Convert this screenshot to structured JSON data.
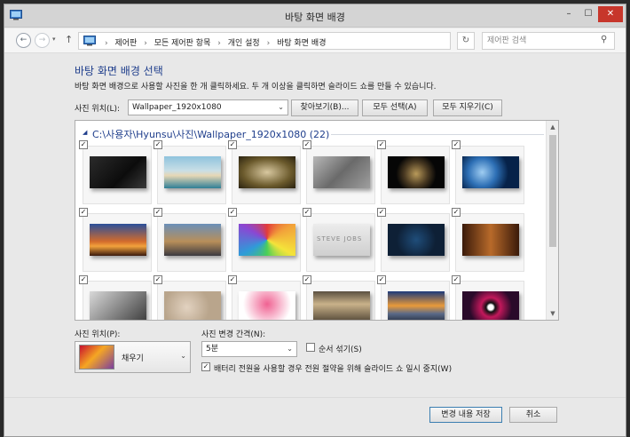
{
  "window": {
    "title": "바탕 화면 배경"
  },
  "titlebar": {
    "min_glyph": "–",
    "max_glyph": "☐",
    "close_glyph": "✕"
  },
  "address": {
    "back_glyph": "←",
    "forward_glyph": "→",
    "recent_glyph": "▾",
    "up_glyph": "↑",
    "crumbs": [
      "제어판",
      "모든 제어판 항목",
      "개인 설정",
      "바탕 화면 배경"
    ],
    "separator": "›",
    "dropdown_glyph": "⌄",
    "refresh_glyph": "↻",
    "search_placeholder": "제어판 검색",
    "search_value": "",
    "search_glyph": "⚲"
  },
  "main": {
    "heading": "바탕 화면 배경 선택",
    "description": "바탕 화면 배경으로 사용할 사진을 한 개 클릭하세요. 두 개 이상을 클릭하면 슬라이드 쇼를 만들 수 있습니다.",
    "location_label": "사진 위치(L):",
    "location_value": "Wallpaper_1920x1080",
    "dropdown_glyph": "⌄",
    "browse_label": "찾아보기(B)...",
    "select_all_label": "모두 선택(A)",
    "clear_all_label": "모두 지우기(C)"
  },
  "gallery": {
    "folder_toggle": "◢",
    "folder_path": "C:\\사용자\\Hyunsu\\사진\\Wallpaper_1920x1080 (22)",
    "check_glyph": "✓",
    "scroll_up_glyph": "▲",
    "scroll_down_glyph": "▼",
    "thumbnails": [
      {
        "name": "dark-laptop",
        "checked": true
      },
      {
        "name": "beach-sky",
        "checked": true
      },
      {
        "name": "glasses",
        "checked": true
      },
      {
        "name": "gray-texture",
        "checked": true
      },
      {
        "name": "asteroid",
        "checked": true
      },
      {
        "name": "earth-space",
        "checked": true
      },
      {
        "name": "eiffel-sunset",
        "checked": true
      },
      {
        "name": "city-skyline",
        "checked": true
      },
      {
        "name": "color-shards",
        "checked": true
      },
      {
        "name": "steve-jobs",
        "checked": true
      },
      {
        "name": "circuit-board",
        "checked": true
      },
      {
        "name": "alley-lanterns",
        "checked": true
      },
      {
        "name": "bw-portrait",
        "checked": true
      },
      {
        "name": "paint-splash",
        "checked": true
      },
      {
        "name": "pink-smoke",
        "checked": true
      },
      {
        "name": "city-aerial",
        "checked": true
      },
      {
        "name": "sunset-city",
        "checked": true
      },
      {
        "name": "pink-eye",
        "checked": true
      }
    ]
  },
  "position": {
    "label": "사진 위치(P):",
    "value": "채우기",
    "dropdown_glyph": "⌄"
  },
  "interval": {
    "label": "사진 변경 간격(N):",
    "value": "5분",
    "dropdown_glyph": "⌄"
  },
  "options": {
    "shuffle_label": "순서 섞기(S)",
    "shuffle_checked": false,
    "battery_label": "배터리 전원을 사용할 경우 전원 절약을 위해 슬라이드 쇼 일시 중지(W)",
    "battery_checked": true,
    "check_glyph": "✓"
  },
  "footer": {
    "save_label": "변경 내용 저장",
    "cancel_label": "취소"
  }
}
